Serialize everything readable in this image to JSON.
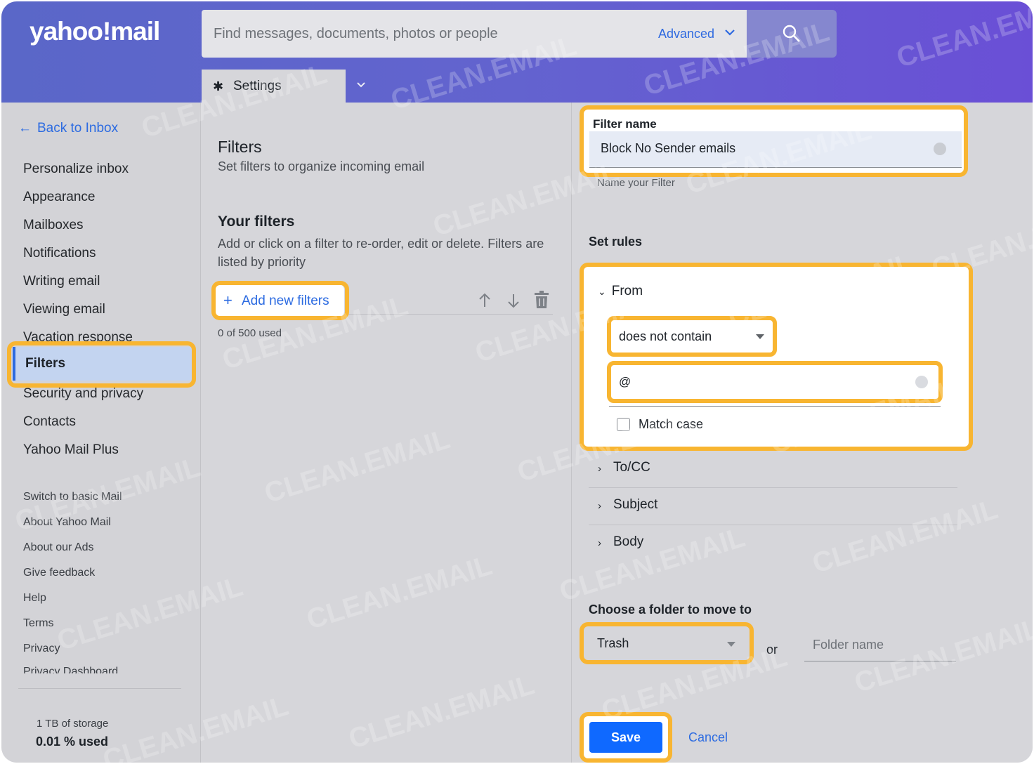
{
  "header": {
    "logo": "yahoo!mail",
    "search_placeholder": "Find messages, documents, photos or people",
    "advanced_label": "Advanced",
    "settings_tab": "Settings"
  },
  "sidebar": {
    "back_label": "Back to Inbox",
    "items": [
      {
        "label": "Personalize inbox"
      },
      {
        "label": "Appearance"
      },
      {
        "label": "Mailboxes"
      },
      {
        "label": "Notifications"
      },
      {
        "label": "Writing email"
      },
      {
        "label": "Viewing email"
      },
      {
        "label": "Vacation response"
      },
      {
        "label": "Filters",
        "active": true
      },
      {
        "label": "Security and privacy"
      },
      {
        "label": "Contacts"
      },
      {
        "label": "Yahoo Mail Plus"
      }
    ],
    "links": [
      {
        "label": "Switch to basic Mail"
      },
      {
        "label": "About Yahoo Mail"
      },
      {
        "label": "About our Ads"
      },
      {
        "label": "Give feedback"
      },
      {
        "label": "Help"
      },
      {
        "label": "Terms"
      },
      {
        "label": "Privacy"
      },
      {
        "label": "Privacy Dashboard"
      }
    ],
    "storage_total": "1 TB of storage",
    "storage_used": "0.01 % used"
  },
  "filters_panel": {
    "title": "Filters",
    "subtitle": "Set filters to organize incoming email",
    "your_filters": "Your filters",
    "description": "Add or click on a filter to re-order, edit or delete. Filters are listed by priority",
    "add_label": "Add new filters",
    "used": "0 of 500 used"
  },
  "editor": {
    "filter_name_label": "Filter name",
    "filter_name_value": "Block No Sender emails",
    "filter_name_hint": "Name your Filter",
    "set_rules": "Set rules",
    "from_label": "From",
    "condition": "does not contain",
    "value": "@",
    "match_case": "Match case",
    "rules": [
      {
        "label": "To/CC"
      },
      {
        "label": "Subject"
      },
      {
        "label": "Body"
      }
    ],
    "choose_folder": "Choose a folder to move to",
    "folder_selected": "Trash",
    "or": "or",
    "folder_placeholder": "Folder name",
    "save": "Save",
    "cancel": "Cancel"
  },
  "watermark": "CLEAN.EMAIL",
  "colors": {
    "accent": "#2c6be1",
    "highlight": "#f8b531",
    "primary_button": "#0f69ff",
    "header_start": "#5a67c8",
    "header_end": "#6a4fd6"
  }
}
